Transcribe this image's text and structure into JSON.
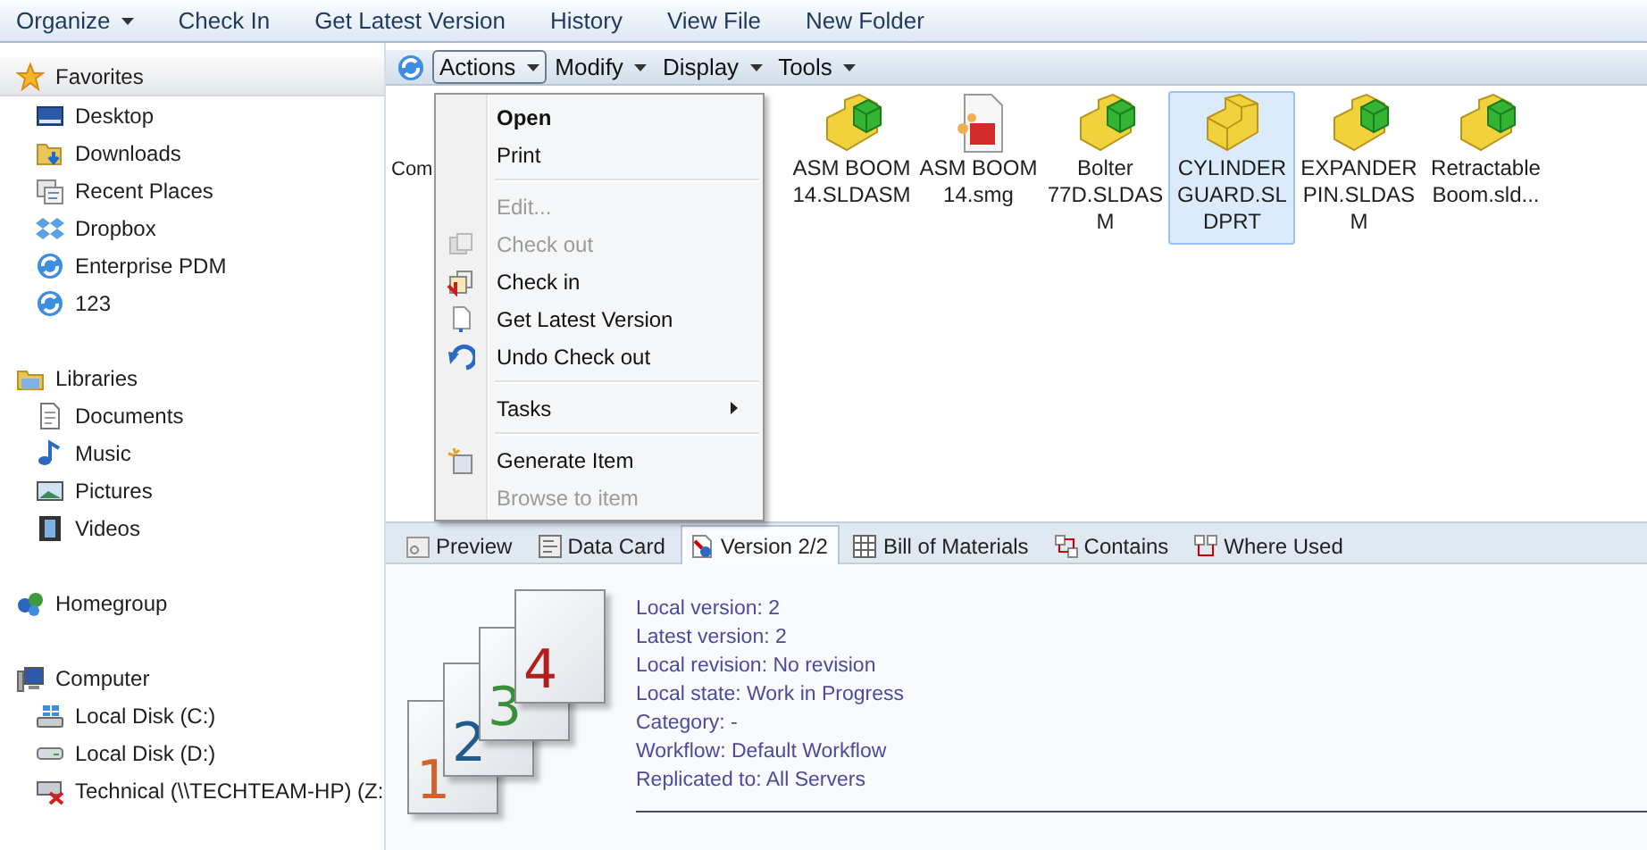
{
  "toolbar": {
    "items": [
      {
        "label": "Organize",
        "dropdown": true
      },
      {
        "label": "Check In",
        "dropdown": false
      },
      {
        "label": "Get Latest Version",
        "dropdown": false
      },
      {
        "label": "History",
        "dropdown": false
      },
      {
        "label": "View File",
        "dropdown": false
      },
      {
        "label": "New Folder",
        "dropdown": false
      }
    ]
  },
  "sidebar": {
    "groups": [
      {
        "label": "Favorites",
        "selected": true,
        "items": [
          {
            "label": "Desktop",
            "selected": false
          },
          {
            "label": "Downloads",
            "selected": false
          },
          {
            "label": "Recent Places",
            "selected": false
          },
          {
            "label": "Dropbox",
            "selected": false
          },
          {
            "label": "Enterprise PDM",
            "selected": false
          },
          {
            "label": "123",
            "selected": false
          }
        ]
      },
      {
        "label": "Libraries",
        "selected": false,
        "items": [
          {
            "label": "Documents",
            "selected": false
          },
          {
            "label": "Music",
            "selected": false
          },
          {
            "label": "Pictures",
            "selected": false
          },
          {
            "label": "Videos",
            "selected": false
          }
        ]
      },
      {
        "label": "Homegroup",
        "selected": false
      },
      {
        "label": "Computer",
        "selected": false,
        "items": [
          {
            "label": "Local Disk (C:)",
            "selected": false
          },
          {
            "label": "Local Disk (D:)",
            "selected": false
          },
          {
            "label": "Technical (\\\\TECHTEAM-HP) (Z:",
            "selected": false
          }
        ]
      }
    ]
  },
  "pane_toolbar": {
    "menus": [
      {
        "label": "Actions",
        "open": true
      },
      {
        "label": "Modify",
        "open": false
      },
      {
        "label": "Display",
        "open": false
      },
      {
        "label": "Tools",
        "open": false
      }
    ]
  },
  "files": [
    {
      "label": "Com",
      "kind": "cut",
      "selected": false
    },
    {
      "label": "ASM BOOM 14.SLDASM",
      "kind": "assembly",
      "selected": false
    },
    {
      "label": "ASM BOOM 14.smg",
      "kind": "composer",
      "selected": false
    },
    {
      "label": "Bolter 77D.SLDASM",
      "kind": "assembly",
      "selected": false
    },
    {
      "label": "CYLINDER GUARD.SLDPRT",
      "kind": "part",
      "selected": true
    },
    {
      "label": "EXPANDER PIN.SLDASM",
      "kind": "assembly",
      "selected": false
    },
    {
      "label": "Retractable Boom.sld...",
      "kind": "assembly",
      "selected": false
    }
  ],
  "actions_menu": {
    "groups": [
      [
        {
          "label": "Open",
          "default": true,
          "disabled": false,
          "submenu": false
        },
        {
          "label": "Print",
          "default": false,
          "disabled": false,
          "submenu": false
        }
      ],
      [
        {
          "label": "Edit...",
          "default": false,
          "disabled": true,
          "submenu": false
        },
        {
          "label": "Check out",
          "default": false,
          "disabled": true,
          "submenu": false
        },
        {
          "label": "Check in",
          "default": false,
          "disabled": false,
          "submenu": false
        },
        {
          "label": "Get Latest Version",
          "default": false,
          "disabled": false,
          "submenu": false
        },
        {
          "label": "Undo Check out",
          "default": false,
          "disabled": false,
          "submenu": false
        }
      ],
      [
        {
          "label": "Tasks",
          "default": false,
          "disabled": false,
          "submenu": true
        }
      ],
      [
        {
          "label": "Generate Item",
          "default": false,
          "disabled": false,
          "submenu": false
        },
        {
          "label": "Browse to item",
          "default": false,
          "disabled": true,
          "submenu": false
        }
      ]
    ]
  },
  "tabs": [
    {
      "label": "Preview",
      "selected": false
    },
    {
      "label": "Data Card",
      "selected": false
    },
    {
      "label": "Version 2/2",
      "selected": true
    },
    {
      "label": "Bill of Materials",
      "selected": false
    },
    {
      "label": "Contains",
      "selected": false
    },
    {
      "label": "Where Used",
      "selected": false
    }
  ],
  "version_panel": {
    "pages": [
      {
        "label": "1",
        "color": "#d2622a"
      },
      {
        "label": "2",
        "color": "#1f5c8c"
      },
      {
        "label": "3",
        "color": "#3a8f3a"
      },
      {
        "label": "4",
        "color": "#b01e1e"
      }
    ],
    "lines": [
      "Local version: 2",
      "Latest version: 2",
      "Local revision: No revision",
      "Local state: Work in Progress",
      "Category: -",
      "Workflow: Default Workflow",
      "Replicated to: All Servers"
    ]
  }
}
